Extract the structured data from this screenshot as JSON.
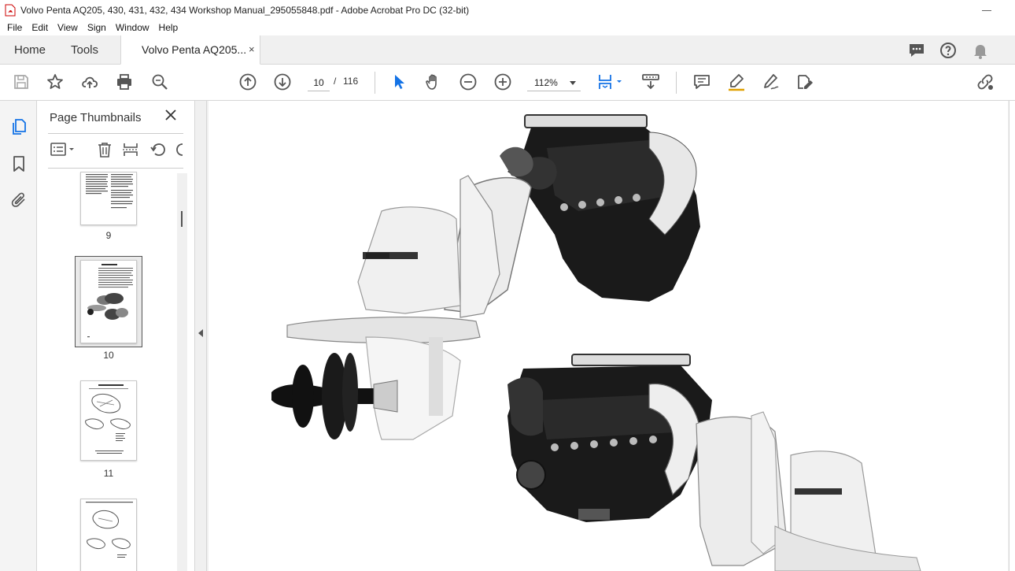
{
  "window": {
    "title": "Volvo Penta AQ205, 430, 431, 432, 434 Workshop Manual_295055848.pdf - Adobe Acrobat Pro DC (32-bit)"
  },
  "menu": [
    "File",
    "Edit",
    "View",
    "Sign",
    "Window",
    "Help"
  ],
  "tabs": {
    "home": "Home",
    "tools": "Tools",
    "document": "Volvo Penta AQ205...",
    "close": "×"
  },
  "toolbar": {
    "current_page": "10",
    "separator": "/",
    "total_pages": "116",
    "zoom": "112%"
  },
  "panel": {
    "title": "Page Thumbnails",
    "thumbnails": [
      {
        "label": "9"
      },
      {
        "label": "10"
      },
      {
        "label": "11"
      },
      {
        "label": ""
      }
    ]
  },
  "colors": {
    "accent": "#1473e6",
    "toolbar_icon": "#555555"
  }
}
